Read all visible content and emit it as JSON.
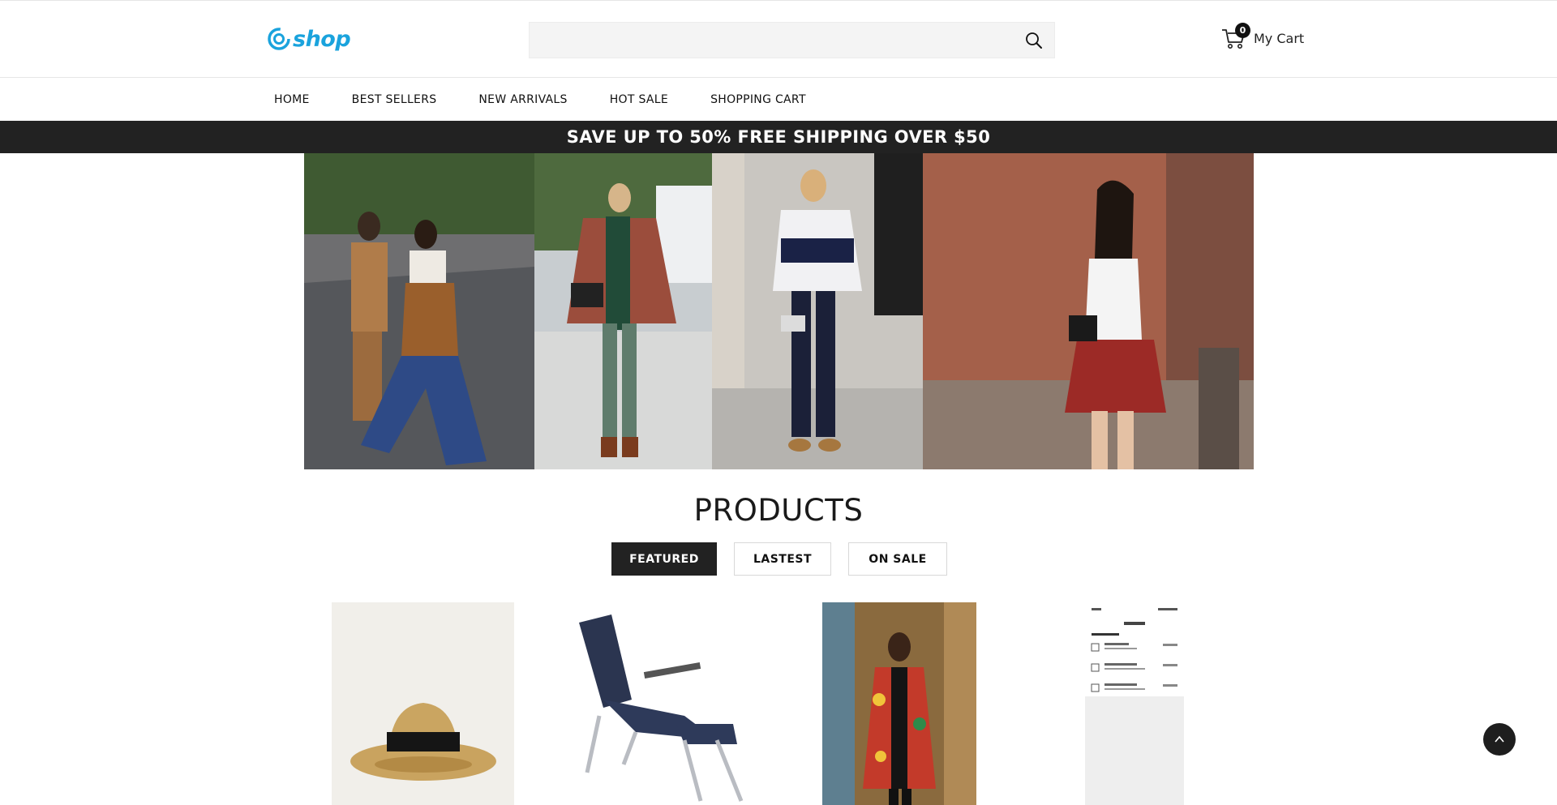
{
  "header": {
    "logo_text": "shop",
    "search_placeholder": "",
    "search_icon": "search-icon",
    "cart_label": "My Cart",
    "cart_count": "0",
    "cart_icon": "shopping-cart-icon"
  },
  "nav": {
    "items": [
      "HOME",
      "BEST SELLERS",
      "NEW ARRIVALS",
      "HOT SALE",
      "SHOPPING CART"
    ]
  },
  "promo": {
    "text": "SAVE UP TO 50% FREE SHIPPING OVER $50"
  },
  "hero": {
    "images": [
      "street-style-two-women",
      "woman-plaid-poncho",
      "woman-striped-tee",
      "woman-plaid-skirt"
    ]
  },
  "products": {
    "title": "PRODUCTS",
    "tabs": [
      "FEATURED",
      "LASTEST",
      "ON SALE"
    ],
    "active_tab": "FEATURED",
    "items": [
      "straw-hat",
      "reclining-chair",
      "african-print-coat",
      "devices-app-screenshot"
    ]
  },
  "colors": {
    "brand": "#1aa3dd",
    "dark": "#222222",
    "promo_bg": "#222222"
  }
}
